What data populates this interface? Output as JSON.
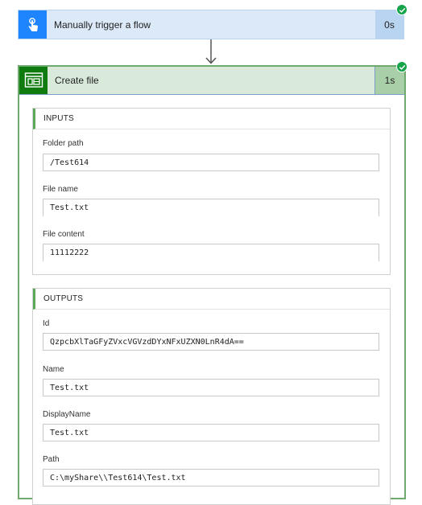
{
  "trigger": {
    "title": "Manually trigger a flow",
    "duration": "0s",
    "icon": "hand-tap-icon",
    "status": "succeeded"
  },
  "action": {
    "title": "Create file",
    "duration": "1s",
    "icon": "file-system-icon",
    "status": "succeeded",
    "inputs": {
      "header": "INPUTS",
      "fields": [
        {
          "label": "Folder path",
          "value": "/Test614"
        },
        {
          "label": "File name",
          "value": "Test.txt"
        },
        {
          "label": "File content",
          "value": "11112222"
        }
      ]
    },
    "outputs": {
      "header": "OUTPUTS",
      "fields": [
        {
          "label": "Id",
          "value": "QzpcbXlTaGFyZVxcVGVzdDYxNFxUZXN0LnR4dA=="
        },
        {
          "label": "Name",
          "value": "Test.txt"
        },
        {
          "label": "DisplayName",
          "value": "Test.txt"
        },
        {
          "label": "Path",
          "value": "C:\\myShare\\\\Test614\\Test.txt"
        }
      ]
    }
  },
  "colors": {
    "trigger_accent": "#1f85ff",
    "action_accent": "#0f7b0f",
    "success": "#17a34a"
  }
}
